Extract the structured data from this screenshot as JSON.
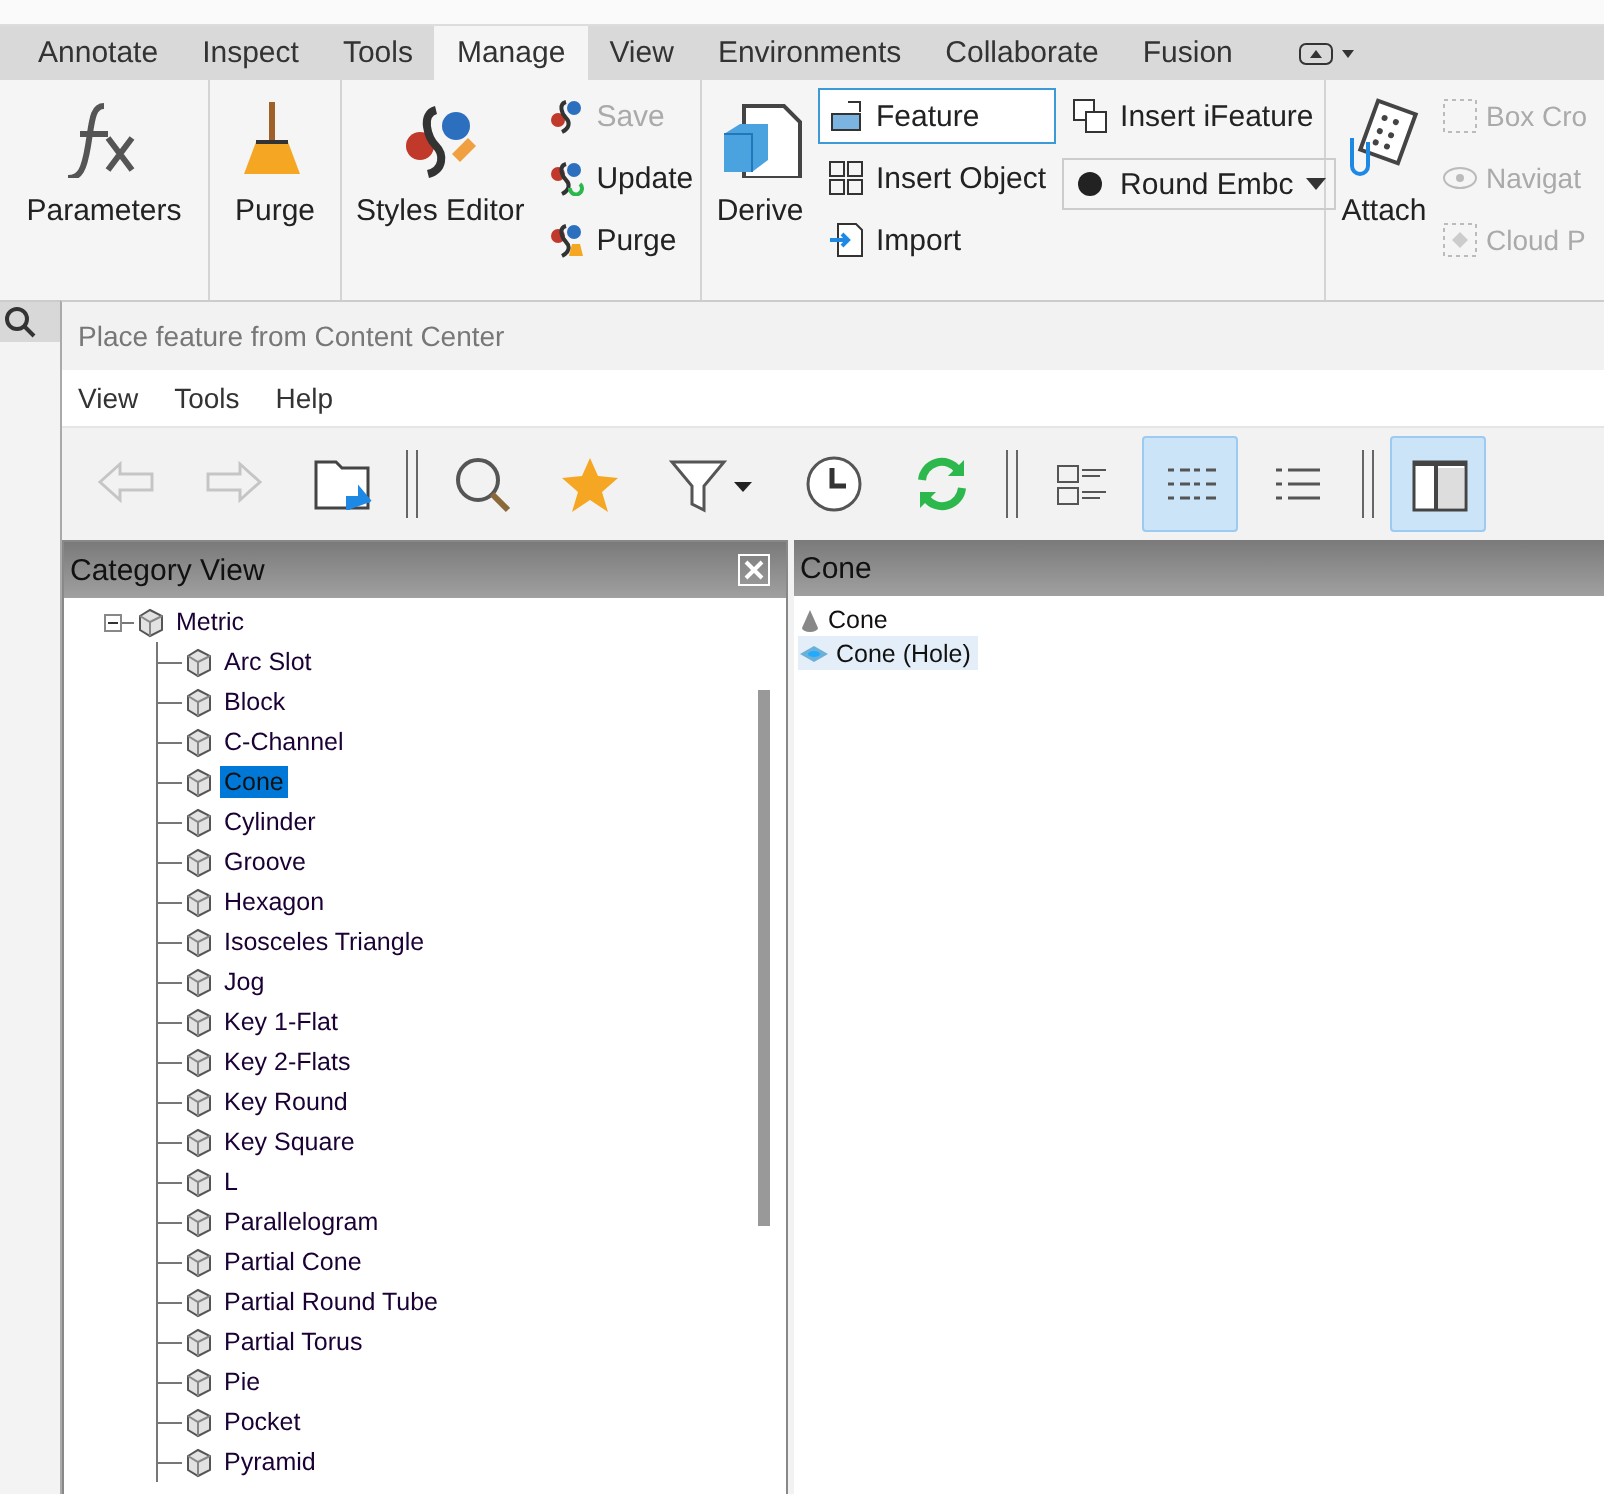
{
  "ribbon": {
    "tabs": [
      {
        "label": "Annotate",
        "selected": false
      },
      {
        "label": "Inspect",
        "selected": false
      },
      {
        "label": "Tools",
        "selected": false
      },
      {
        "label": "Manage",
        "selected": true
      },
      {
        "label": "View",
        "selected": false
      },
      {
        "label": "Environments",
        "selected": false
      },
      {
        "label": "Collaborate",
        "selected": false
      },
      {
        "label": "Fusion",
        "selected": false
      }
    ],
    "groups": [
      {
        "columns": [
          [
            {
              "label": "Parameters",
              "kind": "large",
              "disabled": false,
              "selected": false
            }
          ]
        ]
      },
      {
        "columns": [
          [
            {
              "label": "Purge",
              "kind": "large",
              "disabled": false,
              "selected": false
            }
          ]
        ]
      },
      {
        "columns": [
          [
            {
              "label": "Styles Editor",
              "kind": "large",
              "disabled": false,
              "selected": false
            }
          ],
          [
            {
              "label": "Save",
              "kind": "small",
              "disabled": true,
              "selected": false
            },
            {
              "label": "Update",
              "kind": "small",
              "disabled": false,
              "selected": false
            },
            {
              "label": "Purge",
              "kind": "small",
              "disabled": false,
              "selected": false
            }
          ]
        ]
      },
      {
        "columns": [
          [
            {
              "label": "Derive",
              "kind": "large",
              "disabled": false,
              "selected": false
            }
          ],
          [
            {
              "label": "Feature",
              "kind": "small",
              "disabled": false,
              "selected": true
            },
            {
              "label": "Insert Object",
              "kind": "small",
              "disabled": false,
              "selected": false
            },
            {
              "label": "Import",
              "kind": "small",
              "disabled": false,
              "selected": false
            }
          ],
          [
            {
              "label": "Insert iFeature",
              "kind": "small",
              "disabled": false,
              "selected": false
            },
            {
              "label": "Round Embc",
              "kind": "combo",
              "disabled": false,
              "selected": false
            }
          ]
        ]
      },
      {
        "columns": [
          [
            {
              "label": "Attach",
              "kind": "large",
              "disabled": false,
              "selected": false
            }
          ],
          [
            {
              "label": "Box Cro",
              "kind": "small",
              "disabled": true,
              "selected": false
            },
            {
              "label": "Navigat",
              "kind": "small",
              "disabled": true,
              "selected": false
            },
            {
              "label": "Cloud P",
              "kind": "small",
              "disabled": true,
              "selected": false
            }
          ]
        ]
      }
    ]
  },
  "dialog": {
    "title": "Place feature from Content Center",
    "menu": [
      "View",
      "Tools",
      "Help"
    ],
    "toolbar": [
      {
        "kind": "back",
        "disabled": true,
        "selected": false
      },
      {
        "kind": "forward",
        "disabled": true,
        "selected": false
      },
      {
        "kind": "folder",
        "disabled": false,
        "selected": false
      },
      {
        "kind": "separator"
      },
      {
        "kind": "search",
        "disabled": false,
        "selected": false
      },
      {
        "kind": "star",
        "disabled": false,
        "selected": false
      },
      {
        "kind": "filter",
        "disabled": false,
        "selected": false
      },
      {
        "kind": "history",
        "disabled": false,
        "selected": false
      },
      {
        "kind": "refresh",
        "disabled": false,
        "selected": false
      },
      {
        "kind": "separator"
      },
      {
        "kind": "thumbnails",
        "disabled": false,
        "selected": false
      },
      {
        "kind": "list",
        "disabled": false,
        "selected": true
      },
      {
        "kind": "details",
        "disabled": false,
        "selected": false
      },
      {
        "kind": "separator"
      },
      {
        "kind": "pane",
        "disabled": false,
        "selected": true
      }
    ],
    "category_view": {
      "title": "Category View",
      "tree": [
        {
          "label": "Metric",
          "expanded": true,
          "selected": false,
          "children": [
            {
              "label": "Arc Slot",
              "selected": false
            },
            {
              "label": "Block",
              "selected": false
            },
            {
              "label": "C-Channel",
              "selected": false
            },
            {
              "label": "Cone",
              "selected": true
            },
            {
              "label": "Cylinder",
              "selected": false
            },
            {
              "label": "Groove",
              "selected": false
            },
            {
              "label": "Hexagon",
              "selected": false
            },
            {
              "label": "Isosceles Triangle",
              "selected": false
            },
            {
              "label": "Jog",
              "selected": false
            },
            {
              "label": "Key 1-Flat",
              "selected": false
            },
            {
              "label": "Key 2-Flats",
              "selected": false
            },
            {
              "label": "Key Round",
              "selected": false
            },
            {
              "label": "Key Square",
              "selected": false
            },
            {
              "label": "L",
              "selected": false
            },
            {
              "label": "Parallelogram",
              "selected": false
            },
            {
              "label": "Partial Cone",
              "selected": false
            },
            {
              "label": "Partial Round Tube",
              "selected": false
            },
            {
              "label": "Partial Torus",
              "selected": false
            },
            {
              "label": "Pie",
              "selected": false
            },
            {
              "label": "Pocket",
              "selected": false
            },
            {
              "label": "Pyramid",
              "selected": false
            }
          ]
        }
      ]
    },
    "content": {
      "title": "Cone",
      "items": [
        {
          "label": "Cone",
          "kind": "solid",
          "selected": false
        },
        {
          "label": "Cone (Hole)",
          "kind": "hole",
          "selected": true
        }
      ]
    }
  }
}
